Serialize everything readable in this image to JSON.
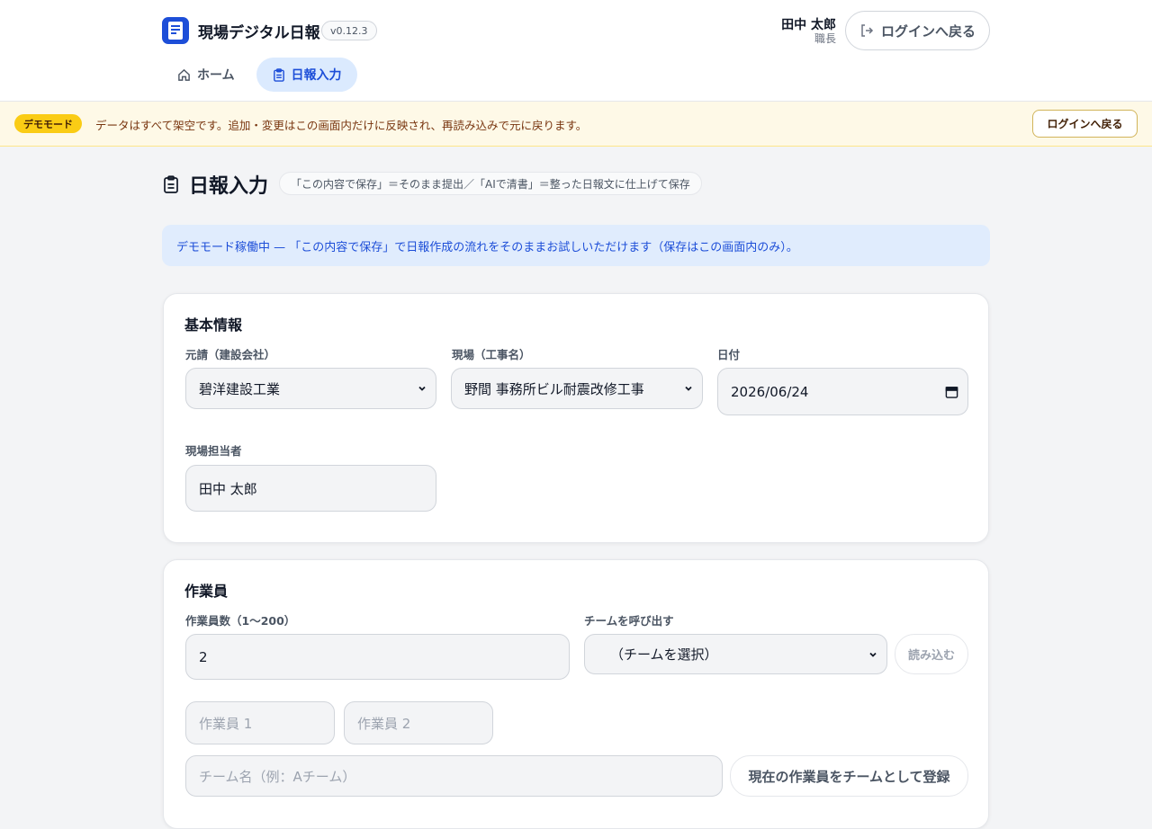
{
  "header": {
    "app_title": "現場デジタル日報",
    "version": "v0.12.3",
    "user_name": "田中 太郎",
    "user_role": "職長",
    "login_back": "ログインへ戻る",
    "nav": [
      {
        "label": "ホーム",
        "icon": "home-icon",
        "active": false
      },
      {
        "label": "日報入力",
        "icon": "clipboard-icon",
        "active": true
      }
    ]
  },
  "demo_banner": {
    "badge": "デモモード",
    "text": "データはすべて架空です。追加・変更はこの画面内だけに反映され、再読み込みで元に戻ります。",
    "login_back": "ログインへ戻る"
  },
  "page": {
    "title": "日報入力",
    "hint": "「この内容で保存」＝そのまま提出／「AIで清書」＝整った日報文に仕上げて保存",
    "info": "デモモード稼働中 — 「この内容で保存」で日報作成の流れをそのままお試しいただけます（保存はこの画面内のみ）。"
  },
  "basic_info": {
    "title": "基本情報",
    "contractor_label": "元請（建設会社）",
    "contractor_value": "碧洋建設工業",
    "site_label": "現場（工事名）",
    "site_value": "野間 事務所ビル耐震改修工事",
    "date_label": "日付",
    "date_value": "2026/06/24",
    "manager_label": "現場担当者",
    "manager_value": "田中 太郎"
  },
  "workers": {
    "title": "作業員",
    "count_label": "作業員数（1〜200）",
    "count_value": "2",
    "team_label": "チームを呼び出す",
    "team_select": "（チームを選択）",
    "load_button": "読み込む",
    "worker_placeholders": [
      "作業員 1",
      "作業員 2"
    ],
    "team_name_placeholder": "チーム名（例：Aチーム）",
    "register_button": "現在の作業員をチームとして登録"
  },
  "colors": {
    "accent": "#1d4ed8",
    "demo_badge": "#facc15",
    "banner_bg": "#fef9e7"
  }
}
